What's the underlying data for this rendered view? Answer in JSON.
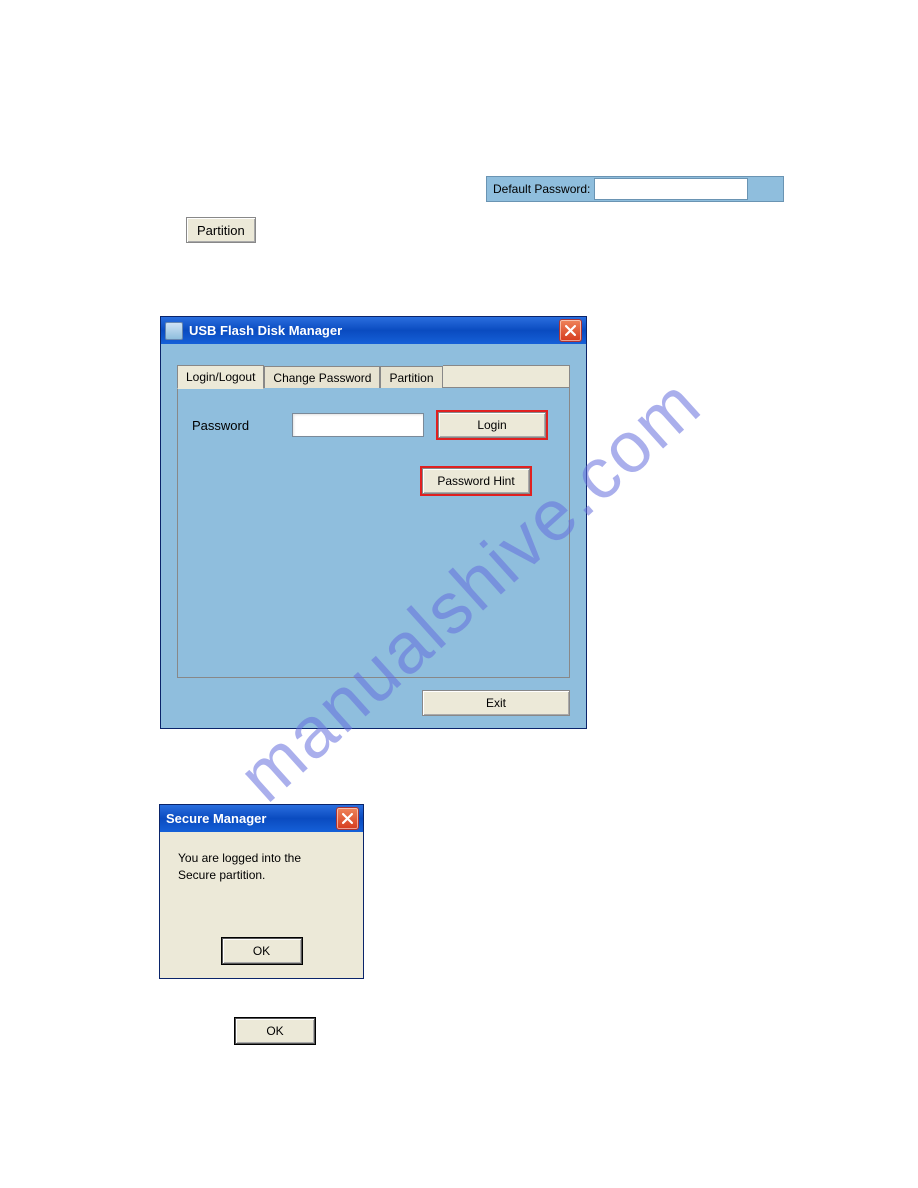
{
  "default_password": {
    "label": "Default Password:"
  },
  "partition_button_label": "Partition",
  "manager": {
    "title": "USB Flash Disk Manager",
    "tabs": [
      "Login/Logout",
      "Change Password",
      "Partition"
    ],
    "active_tab": 0,
    "password_label": "Password",
    "login_button": "Login",
    "hint_button": "Password Hint",
    "exit_button": "Exit"
  },
  "secure_dialog": {
    "title": "Secure Manager",
    "message_line1": "You are logged into the",
    "message_line2": "Secure partition.",
    "ok": "OK"
  },
  "standalone_ok": "OK",
  "watermark": "manualshive.com"
}
